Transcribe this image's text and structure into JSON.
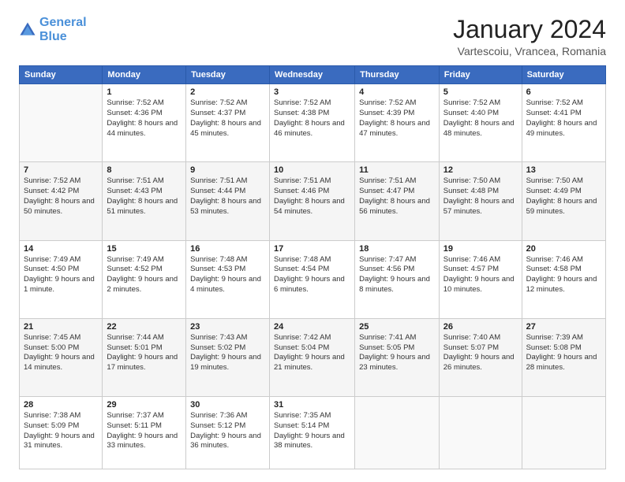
{
  "header": {
    "logo_line1": "General",
    "logo_line2": "Blue",
    "month": "January 2024",
    "location": "Vartescoiu, Vrancea, Romania"
  },
  "weekdays": [
    "Sunday",
    "Monday",
    "Tuesday",
    "Wednesday",
    "Thursday",
    "Friday",
    "Saturday"
  ],
  "weeks": [
    [
      {
        "day": "",
        "sunrise": "",
        "sunset": "",
        "daylight": ""
      },
      {
        "day": "1",
        "sunrise": "Sunrise: 7:52 AM",
        "sunset": "Sunset: 4:36 PM",
        "daylight": "Daylight: 8 hours and 44 minutes."
      },
      {
        "day": "2",
        "sunrise": "Sunrise: 7:52 AM",
        "sunset": "Sunset: 4:37 PM",
        "daylight": "Daylight: 8 hours and 45 minutes."
      },
      {
        "day": "3",
        "sunrise": "Sunrise: 7:52 AM",
        "sunset": "Sunset: 4:38 PM",
        "daylight": "Daylight: 8 hours and 46 minutes."
      },
      {
        "day": "4",
        "sunrise": "Sunrise: 7:52 AM",
        "sunset": "Sunset: 4:39 PM",
        "daylight": "Daylight: 8 hours and 47 minutes."
      },
      {
        "day": "5",
        "sunrise": "Sunrise: 7:52 AM",
        "sunset": "Sunset: 4:40 PM",
        "daylight": "Daylight: 8 hours and 48 minutes."
      },
      {
        "day": "6",
        "sunrise": "Sunrise: 7:52 AM",
        "sunset": "Sunset: 4:41 PM",
        "daylight": "Daylight: 8 hours and 49 minutes."
      }
    ],
    [
      {
        "day": "7",
        "sunrise": "Sunrise: 7:52 AM",
        "sunset": "Sunset: 4:42 PM",
        "daylight": "Daylight: 8 hours and 50 minutes."
      },
      {
        "day": "8",
        "sunrise": "Sunrise: 7:51 AM",
        "sunset": "Sunset: 4:43 PM",
        "daylight": "Daylight: 8 hours and 51 minutes."
      },
      {
        "day": "9",
        "sunrise": "Sunrise: 7:51 AM",
        "sunset": "Sunset: 4:44 PM",
        "daylight": "Daylight: 8 hours and 53 minutes."
      },
      {
        "day": "10",
        "sunrise": "Sunrise: 7:51 AM",
        "sunset": "Sunset: 4:46 PM",
        "daylight": "Daylight: 8 hours and 54 minutes."
      },
      {
        "day": "11",
        "sunrise": "Sunrise: 7:51 AM",
        "sunset": "Sunset: 4:47 PM",
        "daylight": "Daylight: 8 hours and 56 minutes."
      },
      {
        "day": "12",
        "sunrise": "Sunrise: 7:50 AM",
        "sunset": "Sunset: 4:48 PM",
        "daylight": "Daylight: 8 hours and 57 minutes."
      },
      {
        "day": "13",
        "sunrise": "Sunrise: 7:50 AM",
        "sunset": "Sunset: 4:49 PM",
        "daylight": "Daylight: 8 hours and 59 minutes."
      }
    ],
    [
      {
        "day": "14",
        "sunrise": "Sunrise: 7:49 AM",
        "sunset": "Sunset: 4:50 PM",
        "daylight": "Daylight: 9 hours and 1 minute."
      },
      {
        "day": "15",
        "sunrise": "Sunrise: 7:49 AM",
        "sunset": "Sunset: 4:52 PM",
        "daylight": "Daylight: 9 hours and 2 minutes."
      },
      {
        "day": "16",
        "sunrise": "Sunrise: 7:48 AM",
        "sunset": "Sunset: 4:53 PM",
        "daylight": "Daylight: 9 hours and 4 minutes."
      },
      {
        "day": "17",
        "sunrise": "Sunrise: 7:48 AM",
        "sunset": "Sunset: 4:54 PM",
        "daylight": "Daylight: 9 hours and 6 minutes."
      },
      {
        "day": "18",
        "sunrise": "Sunrise: 7:47 AM",
        "sunset": "Sunset: 4:56 PM",
        "daylight": "Daylight: 9 hours and 8 minutes."
      },
      {
        "day": "19",
        "sunrise": "Sunrise: 7:46 AM",
        "sunset": "Sunset: 4:57 PM",
        "daylight": "Daylight: 9 hours and 10 minutes."
      },
      {
        "day": "20",
        "sunrise": "Sunrise: 7:46 AM",
        "sunset": "Sunset: 4:58 PM",
        "daylight": "Daylight: 9 hours and 12 minutes."
      }
    ],
    [
      {
        "day": "21",
        "sunrise": "Sunrise: 7:45 AM",
        "sunset": "Sunset: 5:00 PM",
        "daylight": "Daylight: 9 hours and 14 minutes."
      },
      {
        "day": "22",
        "sunrise": "Sunrise: 7:44 AM",
        "sunset": "Sunset: 5:01 PM",
        "daylight": "Daylight: 9 hours and 17 minutes."
      },
      {
        "day": "23",
        "sunrise": "Sunrise: 7:43 AM",
        "sunset": "Sunset: 5:02 PM",
        "daylight": "Daylight: 9 hours and 19 minutes."
      },
      {
        "day": "24",
        "sunrise": "Sunrise: 7:42 AM",
        "sunset": "Sunset: 5:04 PM",
        "daylight": "Daylight: 9 hours and 21 minutes."
      },
      {
        "day": "25",
        "sunrise": "Sunrise: 7:41 AM",
        "sunset": "Sunset: 5:05 PM",
        "daylight": "Daylight: 9 hours and 23 minutes."
      },
      {
        "day": "26",
        "sunrise": "Sunrise: 7:40 AM",
        "sunset": "Sunset: 5:07 PM",
        "daylight": "Daylight: 9 hours and 26 minutes."
      },
      {
        "day": "27",
        "sunrise": "Sunrise: 7:39 AM",
        "sunset": "Sunset: 5:08 PM",
        "daylight": "Daylight: 9 hours and 28 minutes."
      }
    ],
    [
      {
        "day": "28",
        "sunrise": "Sunrise: 7:38 AM",
        "sunset": "Sunset: 5:09 PM",
        "daylight": "Daylight: 9 hours and 31 minutes."
      },
      {
        "day": "29",
        "sunrise": "Sunrise: 7:37 AM",
        "sunset": "Sunset: 5:11 PM",
        "daylight": "Daylight: 9 hours and 33 minutes."
      },
      {
        "day": "30",
        "sunrise": "Sunrise: 7:36 AM",
        "sunset": "Sunset: 5:12 PM",
        "daylight": "Daylight: 9 hours and 36 minutes."
      },
      {
        "day": "31",
        "sunrise": "Sunrise: 7:35 AM",
        "sunset": "Sunset: 5:14 PM",
        "daylight": "Daylight: 9 hours and 38 minutes."
      },
      {
        "day": "",
        "sunrise": "",
        "sunset": "",
        "daylight": ""
      },
      {
        "day": "",
        "sunrise": "",
        "sunset": "",
        "daylight": ""
      },
      {
        "day": "",
        "sunrise": "",
        "sunset": "",
        "daylight": ""
      }
    ]
  ]
}
